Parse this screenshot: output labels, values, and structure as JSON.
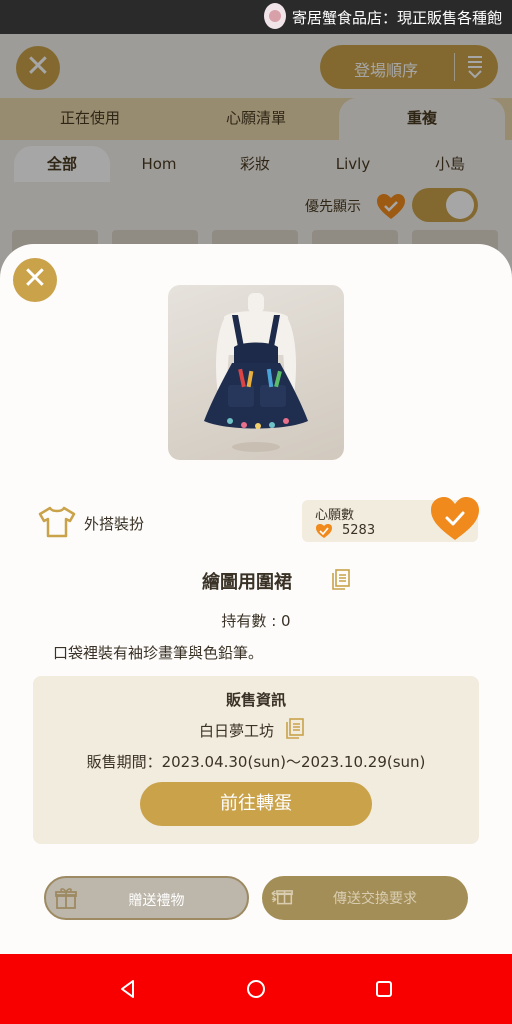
{
  "status_bar": {
    "ticker": "寄居蟹食品店：現正販售各種飽"
  },
  "header": {
    "close_icon": "close-icon",
    "sort_label": "登場順序",
    "sort_icon": "sort-descending-icon"
  },
  "main_tabs": [
    {
      "label": "正在使用",
      "active": false
    },
    {
      "label": "心願清單",
      "active": false
    },
    {
      "label": "重複",
      "active": true
    }
  ],
  "sub_tabs": [
    {
      "label": "全部",
      "active": true
    },
    {
      "label": "Hom",
      "active": false
    },
    {
      "label": "彩妝",
      "active": false
    },
    {
      "label": "Livly",
      "active": false
    },
    {
      "label": "小島",
      "active": false
    }
  ],
  "priority": {
    "label": "優先顯示",
    "toggle_on": true
  },
  "modal": {
    "close_icon": "close-icon",
    "category": {
      "icon": "shirt-icon",
      "label": "外搭裝扮"
    },
    "wishlist": {
      "title": "心願數",
      "count": "5283",
      "added": true
    },
    "item_name": "繪圖用圍裙",
    "owned": "持有數 : 0",
    "description": "口袋裡裝有袖珍畫筆與色鉛筆。",
    "sales": {
      "title": "販售資訊",
      "shop": "白日夢工坊",
      "period": "販售期間：2023.04.30(sun)～2023.10.29(sun)",
      "gacha_button": "前往轉蛋"
    },
    "gift_button": "贈送禮物",
    "trade_button": "傳送交換要求"
  },
  "colors": {
    "gold": "#c9a24a",
    "orange": "#f08a1c",
    "panel": "#f2ecde",
    "nav_bar": "#f90000"
  }
}
